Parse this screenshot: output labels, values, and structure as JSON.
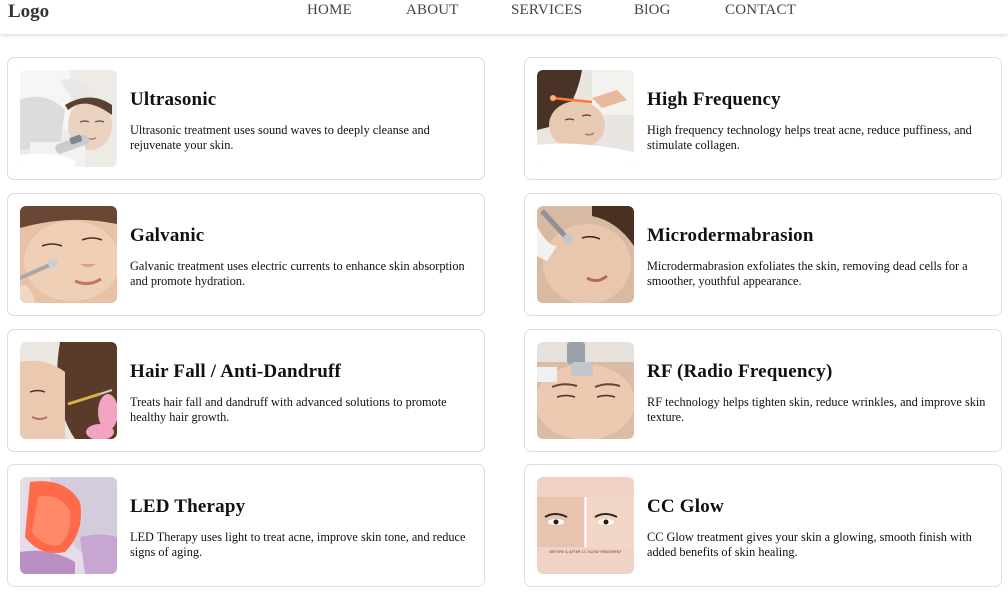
{
  "nav": {
    "logo": "Logo",
    "links": [
      "HOME",
      "ABOUT",
      "SERVICES",
      "BlOG",
      "CONTACT"
    ]
  },
  "services": [
    {
      "title": "Ultrasonic",
      "description": "Ultrasonic treatment uses sound waves to deeply cleanse and rejuvenate your skin.",
      "icon": "ultrasonic-facial-photo"
    },
    {
      "title": "High Frequency",
      "description": "High frequency technology helps treat acne, reduce puffiness, and stimulate collagen.",
      "icon": "high-frequency-facial-photo"
    },
    {
      "title": "Galvanic",
      "description": "Galvanic treatment uses electric currents to enhance skin absorption and promote hydration.",
      "icon": "galvanic-facial-photo"
    },
    {
      "title": "Microdermabrasion",
      "description": "Microdermabrasion exfoliates the skin, removing dead cells for a smoother, youthful appearance.",
      "icon": "microdermabrasion-facial-photo"
    },
    {
      "title": "Hair Fall / Anti-Dandruff",
      "description": "Treats hair fall and dandruff with advanced solutions to promote healthy hair growth.",
      "icon": "scalp-treatment-photo"
    },
    {
      "title": "RF (Radio Frequency)",
      "description": "RF technology helps tighten skin, reduce wrinkles, and improve skin texture.",
      "icon": "rf-facial-photo"
    },
    {
      "title": "LED Therapy",
      "description": "LED Therapy uses light to treat acne, improve skin tone, and reduce signs of aging.",
      "icon": "led-mask-photo"
    },
    {
      "title": "CC Glow",
      "description": "CC Glow treatment gives your skin a glowing, smooth finish with added benefits of skin healing.",
      "icon": "before-after-eyes-photo",
      "image_caption": "BEFORE & AFTER CC GLOW TREATMENT"
    }
  ]
}
